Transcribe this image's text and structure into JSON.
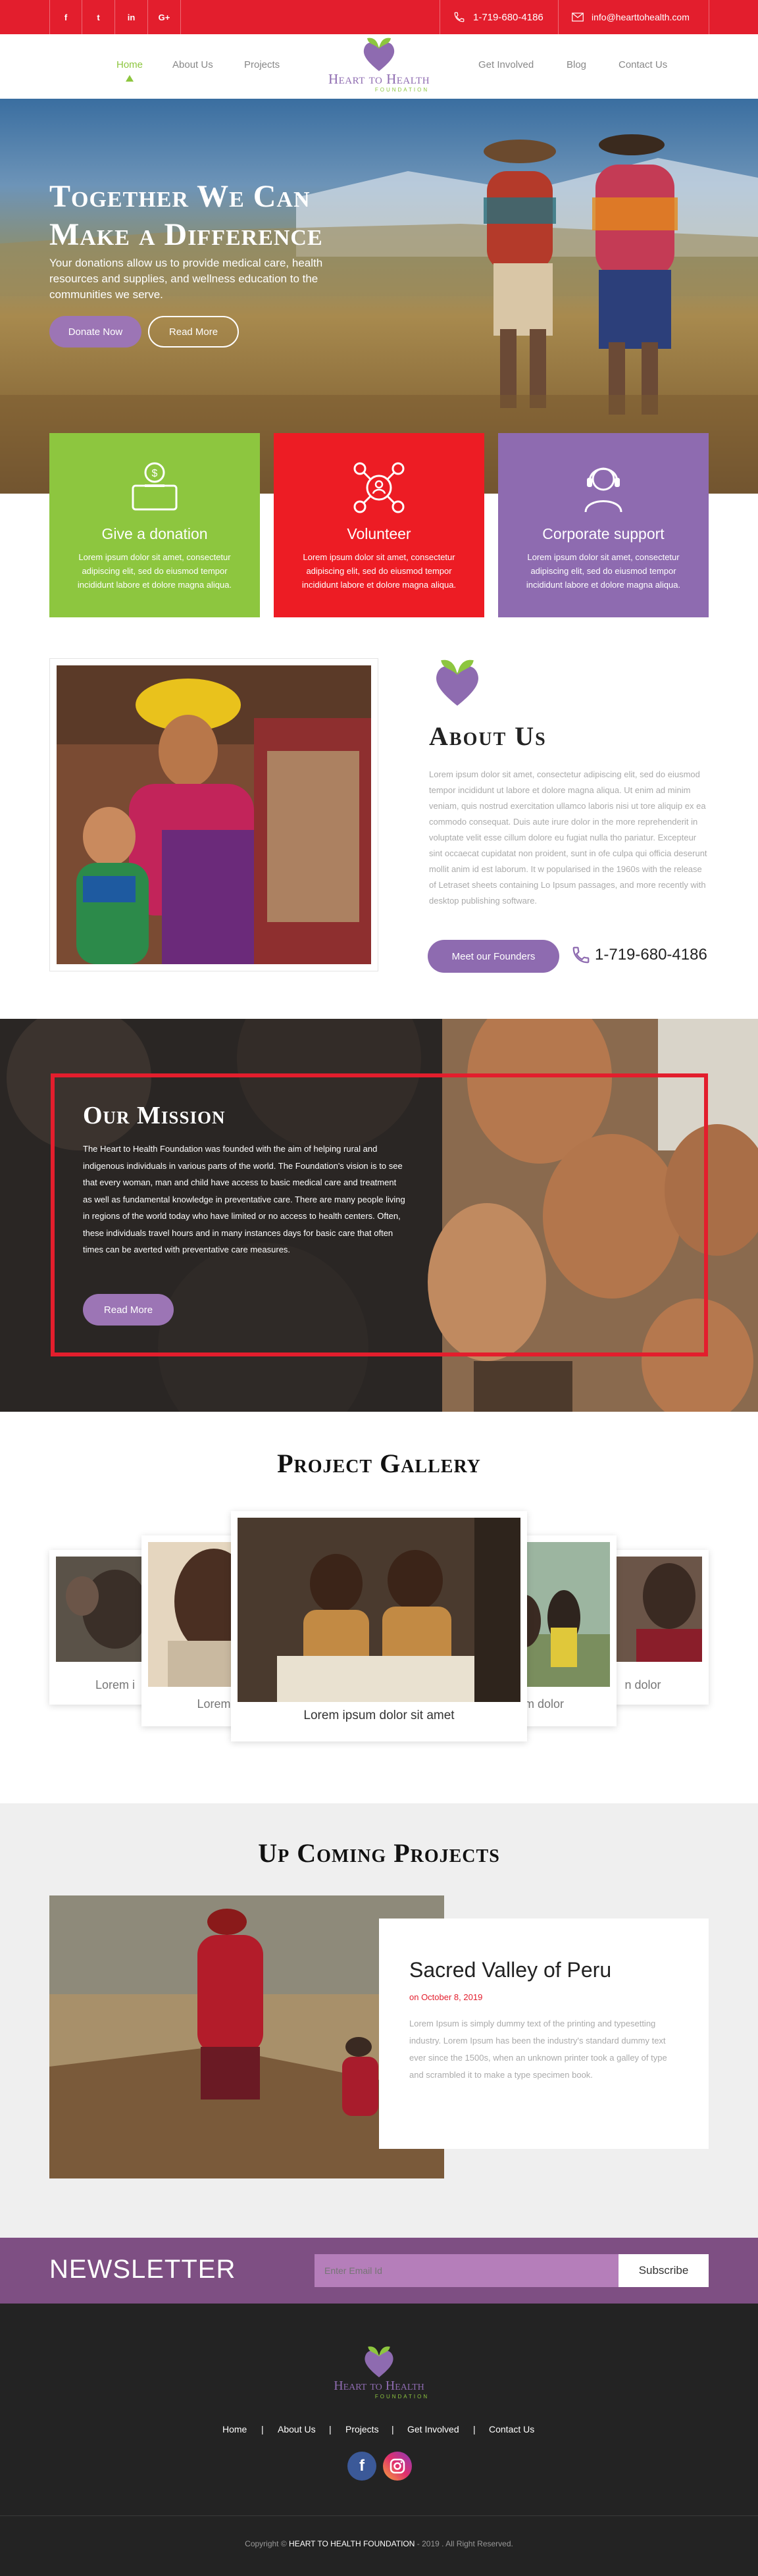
{
  "topbar": {
    "social": [
      {
        "icon": "facebook-icon",
        "glyph": "f"
      },
      {
        "icon": "twitter-icon",
        "glyph": "t"
      },
      {
        "icon": "linkedin-icon",
        "glyph": "in"
      },
      {
        "icon": "google-plus-icon",
        "glyph": "G+"
      }
    ],
    "phone": "1-719-680-4186",
    "email": "info@hearttohealth.com"
  },
  "nav": {
    "items": [
      "Home",
      "About Us",
      "Projects",
      "Get Involved",
      "Blog",
      "Contact Us"
    ],
    "active": "Home"
  },
  "logo": {
    "name": "Heart to Health",
    "sub": "FOUNDATION"
  },
  "hero": {
    "title_line1": "Together We Can",
    "title_line2": "Make a Difference",
    "text": "Your donations allow us to provide medical care, health resources and supplies, and wellness education to the communities we serve.",
    "primary_button": "Donate Now",
    "secondary_button": "Read More"
  },
  "cards": [
    {
      "title": "Give a donation",
      "text": "Lorem ipsum dolor sit amet, consectetur adipiscing elit, sed do eiusmod tempor incididunt labore et dolore magna aliqua.",
      "color": "#8dc63f",
      "icon": "donation-box-icon"
    },
    {
      "title": "Volunteer",
      "text": "Lorem ipsum dolor sit amet, consectetur adipiscing elit, sed do eiusmod tempor incididunt labore et dolore magna aliqua.",
      "color": "#ed1c24",
      "icon": "volunteer-network-icon"
    },
    {
      "title": "Corporate support",
      "text": "Lorem ipsum dolor sit amet, consectetur adipiscing elit, sed do eiusmod tempor incididunt labore et dolore magna aliqua.",
      "color": "#8e6bb0",
      "icon": "support-agent-icon"
    }
  ],
  "about": {
    "title": "About Us",
    "text": "Lorem ipsum dolor sit amet, consectetur adipiscing elit, sed do eiusmod tempor incididunt ut labore et dolore magna aliqua. Ut enim ad minim veniam, quis nostrud exercitation ullamco laboris nisi ut tore aliquip ex ea commodo consequat. Duis aute irure dolor in the more reprehenderit in voluptate velit esse cillum dolore eu fugiat nulla tho pariatur. Excepteur sint occaecat cupidatat non proident, sunt in ofe culpa qui officia deserunt mollit anim id est laborum. It w popularised in the 1960s with the release of Letraset sheets containing Lo Ipsum passages, and more recently with desktop publishing software.",
    "button": "Meet our Founders",
    "phone": "1-719-680-4186"
  },
  "mission": {
    "title": "Our Mission",
    "text": "The Heart to Health Foundation was founded with the aim of helping rural and indigenous individuals in various parts of the world. The Foundation's vision is to see that every woman, man and child have access to basic medical care and treatment as well as fundamental knowledge in preventative care. There are many people living in regions of the world today who have limited or no access to health centers. Often, these individuals travel hours and in many instances days for basic care that often times can be averted with preventative care measures.",
    "button": "Read More"
  },
  "gallery": {
    "title": "Project Gallery",
    "center_caption": "Lorem ipsum dolor sit amet",
    "left_caption_outer": "Lorem i",
    "left_caption_inner": "Lorem",
    "right_caption_inner": "m dolor",
    "right_caption_outer": "n dolor"
  },
  "upcoming": {
    "title": "Up Coming Projects",
    "project_title": "Sacred Valley of Peru",
    "date": "on October 8, 2019",
    "text": "Lorem Ipsum is simply dummy text of the printing and typesetting industry. Lorem Ipsum has been the industry's standard dummy text ever since the 1500s, when an unknown printer took a galley of type and scrambled it to make a type specimen book."
  },
  "newsletter": {
    "title": "NEWSLETTER",
    "placeholder": "Enter Email Id",
    "button": "Subscribe"
  },
  "footer": {
    "links": [
      "Home",
      "About Us",
      "Projects",
      "Get Involved",
      "Contact Us"
    ],
    "separator": "|",
    "copyright_prefix": "Copyright ©",
    "copyright_org": "HEART TO HEALTH FOUNDATION",
    "copyright_suffix": "- 2019 . All Right Reserved."
  },
  "colors": {
    "accent_red": "#e31e2d",
    "accent_green": "#8dc63f",
    "accent_purple": "#8e6bb0",
    "footer_bg": "#232323"
  }
}
